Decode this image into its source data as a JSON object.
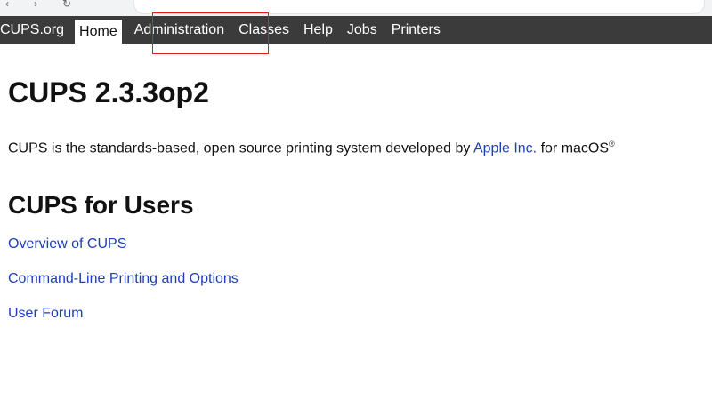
{
  "browser": {
    "back_icon": "back-arrow-icon",
    "forward_icon": "forward-arrow-icon",
    "reload_icon": "reload-icon"
  },
  "navbar": {
    "items": [
      {
        "label": "CUPS.org"
      },
      {
        "label": "Home"
      },
      {
        "label": "Administration"
      },
      {
        "label": "Classes"
      },
      {
        "label": "Help"
      },
      {
        "label": "Jobs"
      },
      {
        "label": "Printers"
      }
    ],
    "active_item": "Home",
    "highlighted_item": "Administration",
    "bar_color": "#3b3b3b",
    "highlight_color": "#e02020"
  },
  "main": {
    "title": "CUPS 2.3.3op2",
    "intro": {
      "text_before": "CUPS is the standards-based, open source printing system developed by ",
      "link": "Apple Inc.",
      "text_after": " for macOS",
      "superscript": "®"
    },
    "section_title": "CUPS for Users",
    "links": [
      {
        "label": "Overview of CUPS"
      },
      {
        "label": "Command-Line Printing and Options"
      },
      {
        "label": "User Forum"
      }
    ],
    "link_color": "#1e3fb8"
  }
}
